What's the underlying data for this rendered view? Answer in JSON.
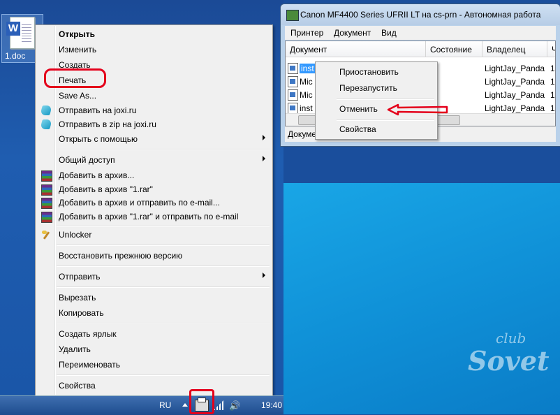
{
  "desktop": {
    "file_name": "1.doc"
  },
  "context_menu": {
    "items": [
      {
        "label": "Открыть"
      },
      {
        "label": "Изменить"
      },
      {
        "label": "Создать"
      },
      {
        "label": "Печать"
      },
      {
        "label": "Save As..."
      },
      {
        "label": "Отправить на joxi.ru"
      },
      {
        "label": "Отправить в zip на joxi.ru"
      },
      {
        "label": "Открыть с помощью"
      },
      {
        "label": "Общий доступ"
      },
      {
        "label": "Добавить в архив..."
      },
      {
        "label": "Добавить в архив \"1.rar\""
      },
      {
        "label": "Добавить в архив и отправить по e-mail..."
      },
      {
        "label": "Добавить в архив \"1.rar\" и отправить по e-mail"
      },
      {
        "label": "Unlocker"
      },
      {
        "label": "Восстановить прежнюю версию"
      },
      {
        "label": "Отправить"
      },
      {
        "label": "Вырезать"
      },
      {
        "label": "Копировать"
      },
      {
        "label": "Создать ярлык"
      },
      {
        "label": "Удалить"
      },
      {
        "label": "Переименовать"
      },
      {
        "label": "Свойства"
      }
    ]
  },
  "printer_window": {
    "title": "Canon MF4400 Series UFRII LT на cs-prn - Автономная работа",
    "menu": [
      "Принтер",
      "Документ",
      "Вид"
    ],
    "columns": [
      "Документ",
      "Состояние",
      "Владелец",
      "Чи"
    ],
    "rows": [
      {
        "doc": "inst",
        "owner": "LightJay_Panda",
        "num": "1"
      },
      {
        "doc": "Mic",
        "owner": "LightJay_Panda",
        "num": "1"
      },
      {
        "doc": "Mic",
        "owner": "LightJay_Panda",
        "num": "1"
      },
      {
        "doc": "inst",
        "owner": "LightJay_Panda",
        "num": "1"
      }
    ],
    "status": "Докуме",
    "context_menu": [
      "Приостановить",
      "Перезапустить",
      "Отменить",
      "Свойства"
    ]
  },
  "taskbar": {
    "lang": "RU",
    "time": "19:40"
  },
  "watermark": {
    "top": "club",
    "bottom": "Sovet"
  },
  "colors": {
    "highlight_red": "#e4001b",
    "selection": "#3399ff"
  }
}
